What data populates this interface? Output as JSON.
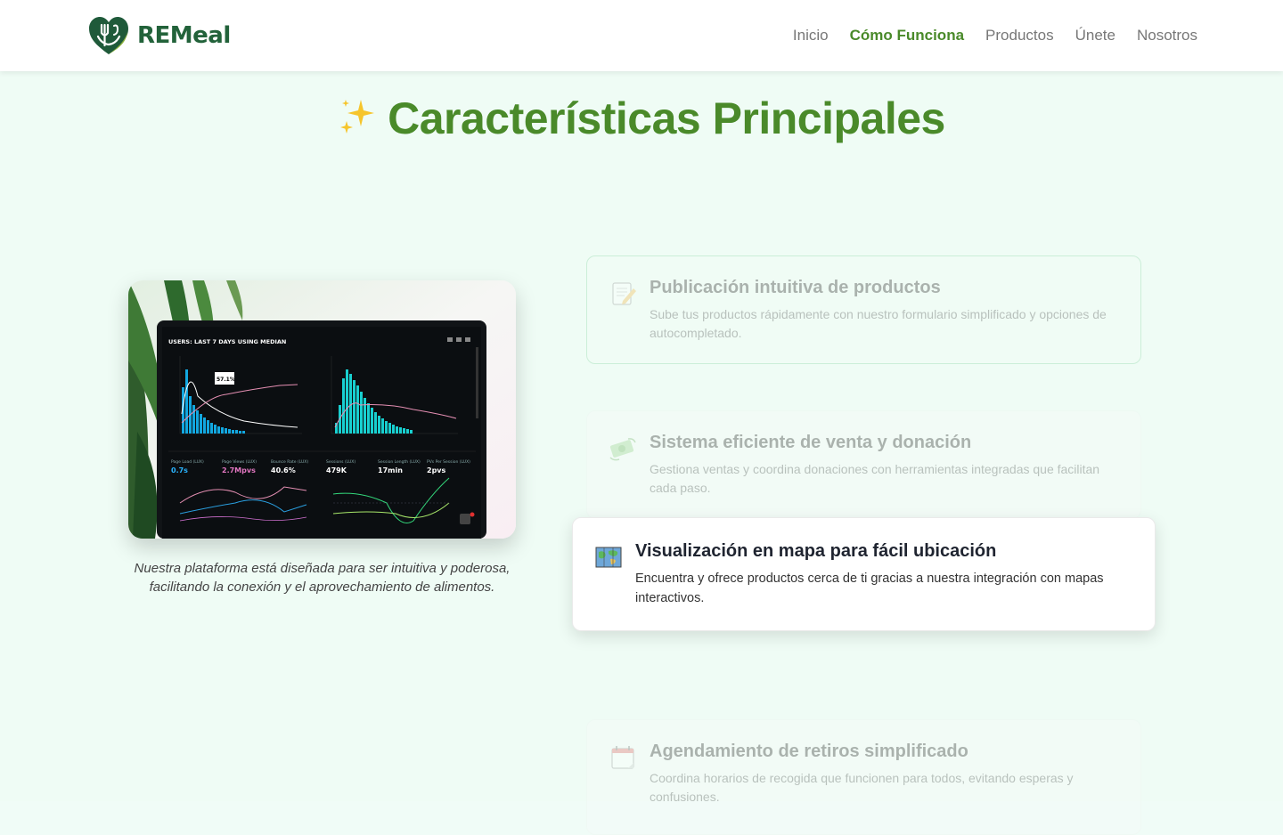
{
  "brand": {
    "name": "REMeal"
  },
  "nav": {
    "items": [
      {
        "label": "Inicio"
      },
      {
        "label": "Cómo Funciona",
        "active": true
      },
      {
        "label": "Productos"
      },
      {
        "label": "Únete"
      },
      {
        "label": "Nosotros"
      }
    ]
  },
  "section": {
    "title_icon": "✨",
    "title": "Características Principales",
    "caption": "Nuestra plataforma está diseñada para ser intuitiva y poderosa, facilitando la conexión y el aprovechamiento de alimentos."
  },
  "features": [
    {
      "icon": "notepad-icon",
      "title": "Publicación intuitiva de productos",
      "description": "Sube tus productos rápidamente con nuestro formulario simplificado y opciones de autocompletado."
    },
    {
      "icon": "money-icon",
      "title": "Sistema eficiente de venta y donación",
      "description": "Gestiona ventas y coordina donaciones con herramientas integradas que facilitan cada paso."
    },
    {
      "icon": "map-icon",
      "title": "Visualización en mapa para fácil ubicación",
      "description": "Encuentra y ofrece productos cerca de ti gracias a nuestra integración con mapas interactivos."
    },
    {
      "icon": "calendar-icon",
      "title": "Agendamiento de retiros simplificado",
      "description": "Coordina horarios de recogida que funcionen para todos, evitando esperas y confusiones."
    }
  ],
  "dashboard_image": {
    "header_text": "USERS: LAST 7 DAYS USING MEDIAN",
    "tooltip_value": "57.1%",
    "metrics": [
      {
        "label": "Page Load (LUX)",
        "value": "0.7s"
      },
      {
        "label": "Page Views (LUX)",
        "value": "2.7Mpvs"
      },
      {
        "label": "Bounce Rate (LUX)",
        "value": "40.6%"
      },
      {
        "label": "Sessions (LUX)",
        "value": "479K"
      },
      {
        "label": "Session Length (LUX)",
        "value": "17min"
      },
      {
        "label": "PVs Per Session (LUX)",
        "value": "2pvs"
      }
    ]
  }
}
